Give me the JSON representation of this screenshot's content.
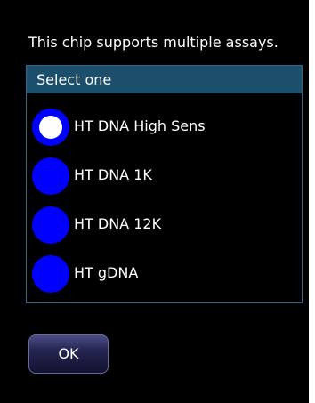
{
  "dialog": {
    "message": "This chip supports multiple assays.",
    "panel_title": "Select one",
    "options": [
      {
        "label": "HT DNA High Sens",
        "selected": true
      },
      {
        "label": "HT DNA 1K",
        "selected": false
      },
      {
        "label": "HT DNA 12K",
        "selected": false
      },
      {
        "label": "HT gDNA",
        "selected": false
      }
    ],
    "ok_label": "OK"
  },
  "colors": {
    "background": "#000000",
    "panel_header": "#1b4f6b",
    "radio": "#0000ff",
    "radio_selected_dot": "#ffffff"
  },
  "icons": {
    "radio": "radio-button-icon"
  }
}
